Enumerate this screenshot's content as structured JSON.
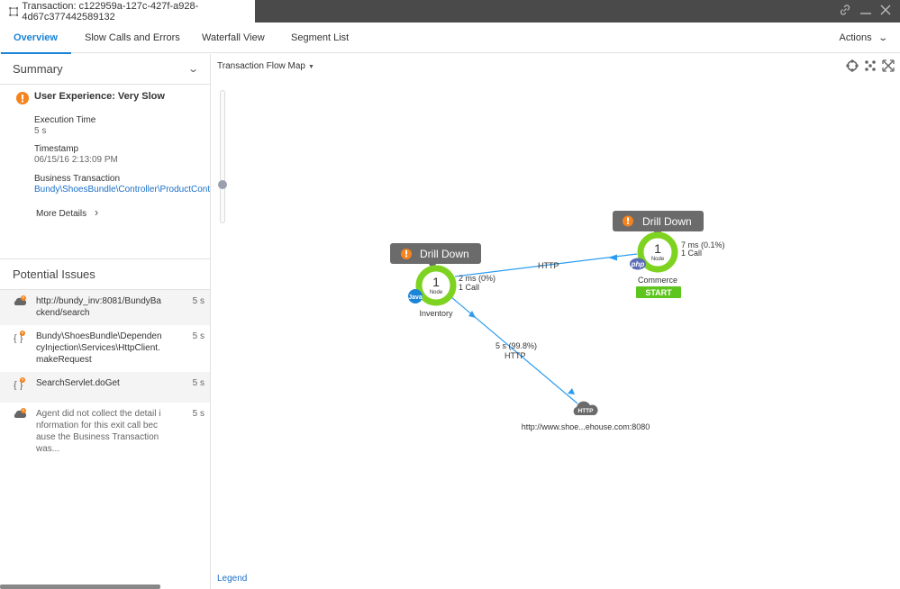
{
  "window": {
    "title": "Transaction: c122959a-127c-427f-a928-4d67c377442589132",
    "controls": {
      "link": "🔗",
      "minimize": "—",
      "close": "✕"
    }
  },
  "tabs": [
    {
      "label": "Overview",
      "active": true
    },
    {
      "label": "Slow Calls and Errors",
      "active": false
    },
    {
      "label": "Waterfall View",
      "active": false
    },
    {
      "label": "Segment List",
      "active": false
    }
  ],
  "actions_label": "Actions",
  "summary": {
    "heading": "Summary",
    "user_experience": "User Experience: Very Slow",
    "execution_time_label": "Execution Time",
    "execution_time_value": "5 s",
    "timestamp_label": "Timestamp",
    "timestamp_value": "06/15/16 2:13:09 PM",
    "bt_label": "Business Transaction",
    "bt_value": "Bundy\\ShoesBundle\\Controller\\ProductController",
    "more_details": "More Details"
  },
  "issues": {
    "heading": "Potential Issues",
    "items": [
      {
        "icon": "cloud-warning-icon",
        "lines": [
          "http://bundy_inv:8081/BundyBa",
          "ckend/search"
        ],
        "duration": "5 s"
      },
      {
        "icon": "code-warning-icon",
        "lines": [
          "Bundy\\ShoesBundle\\Dependen",
          "cyInjection\\Services\\HttpClient.",
          "makeRequest"
        ],
        "duration": "5 s"
      },
      {
        "icon": "code-warning-icon",
        "lines": [
          "SearchServlet.doGet"
        ],
        "duration": "5 s"
      },
      {
        "icon": "cloud-warning-icon",
        "lines": [
          "Agent did not collect the detail i",
          "nformation for this exit call bec",
          "ause the Business Transaction",
          "was..."
        ],
        "duration": "5 s"
      }
    ]
  },
  "flowmap": {
    "title": "Transaction Flow Map",
    "zoom_level": 0.25,
    "legend": "Legend",
    "colors": {
      "node_ring": "#7ed321",
      "edge": "#2d9cf0",
      "popup": "#6b6b6b",
      "warning": "#f5841f",
      "start": "#5ec41e",
      "java": "#1b84d6",
      "php": "#5a6cb6",
      "cloud": "#6b6b6b"
    },
    "nodes": [
      {
        "id": "inventory",
        "name": "Inventory",
        "count": "1",
        "count_label": "Node",
        "tech": "Java",
        "drill": "Drill Down",
        "stats": [
          "2 ms (0%)",
          "1 Call"
        ]
      },
      {
        "id": "commerce",
        "name": "Commerce",
        "count": "1",
        "count_label": "Node",
        "tech": "php",
        "drill": "Drill Down",
        "stats": [
          "7 ms (0.1%)",
          "1 Call"
        ],
        "badge": "START"
      },
      {
        "id": "http",
        "name": "http://www.shoe...ehouse.com:8080",
        "tech": "HTTP"
      }
    ],
    "edges": [
      {
        "from": "commerce",
        "to": "inventory",
        "label": "HTTP"
      },
      {
        "from": "inventory",
        "to": "http",
        "labels": [
          "5 s (99.8%)",
          "HTTP"
        ]
      }
    ]
  }
}
